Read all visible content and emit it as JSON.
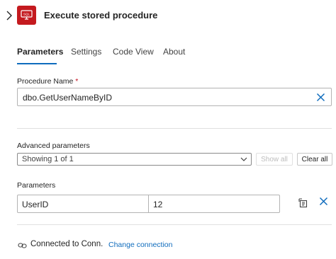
{
  "header": {
    "title": "Execute stored procedure",
    "icon": "sql-server-icon",
    "icon_text": "SQL",
    "brand_color": "#c41a1f"
  },
  "tabs": [
    {
      "label": "Parameters",
      "active": true
    },
    {
      "label": "Settings",
      "active": false
    },
    {
      "label": "Code View",
      "active": false
    },
    {
      "label": "About",
      "active": false
    }
  ],
  "procedure": {
    "label": "Procedure Name",
    "required_marker": "*",
    "value": "dbo.GetUserNameByID"
  },
  "advanced": {
    "label": "Advanced parameters",
    "selected": "Showing 1 of 1",
    "show_all_label": "Show all",
    "clear_all_label": "Clear all"
  },
  "parameters": {
    "label": "Parameters",
    "rows": [
      {
        "name": "UserID",
        "value": "12"
      }
    ]
  },
  "footer": {
    "connected_text": "Connected to Conn.",
    "change_link": "Change connection"
  },
  "colors": {
    "accent": "#0f6cbd",
    "required": "#c50f1f"
  }
}
